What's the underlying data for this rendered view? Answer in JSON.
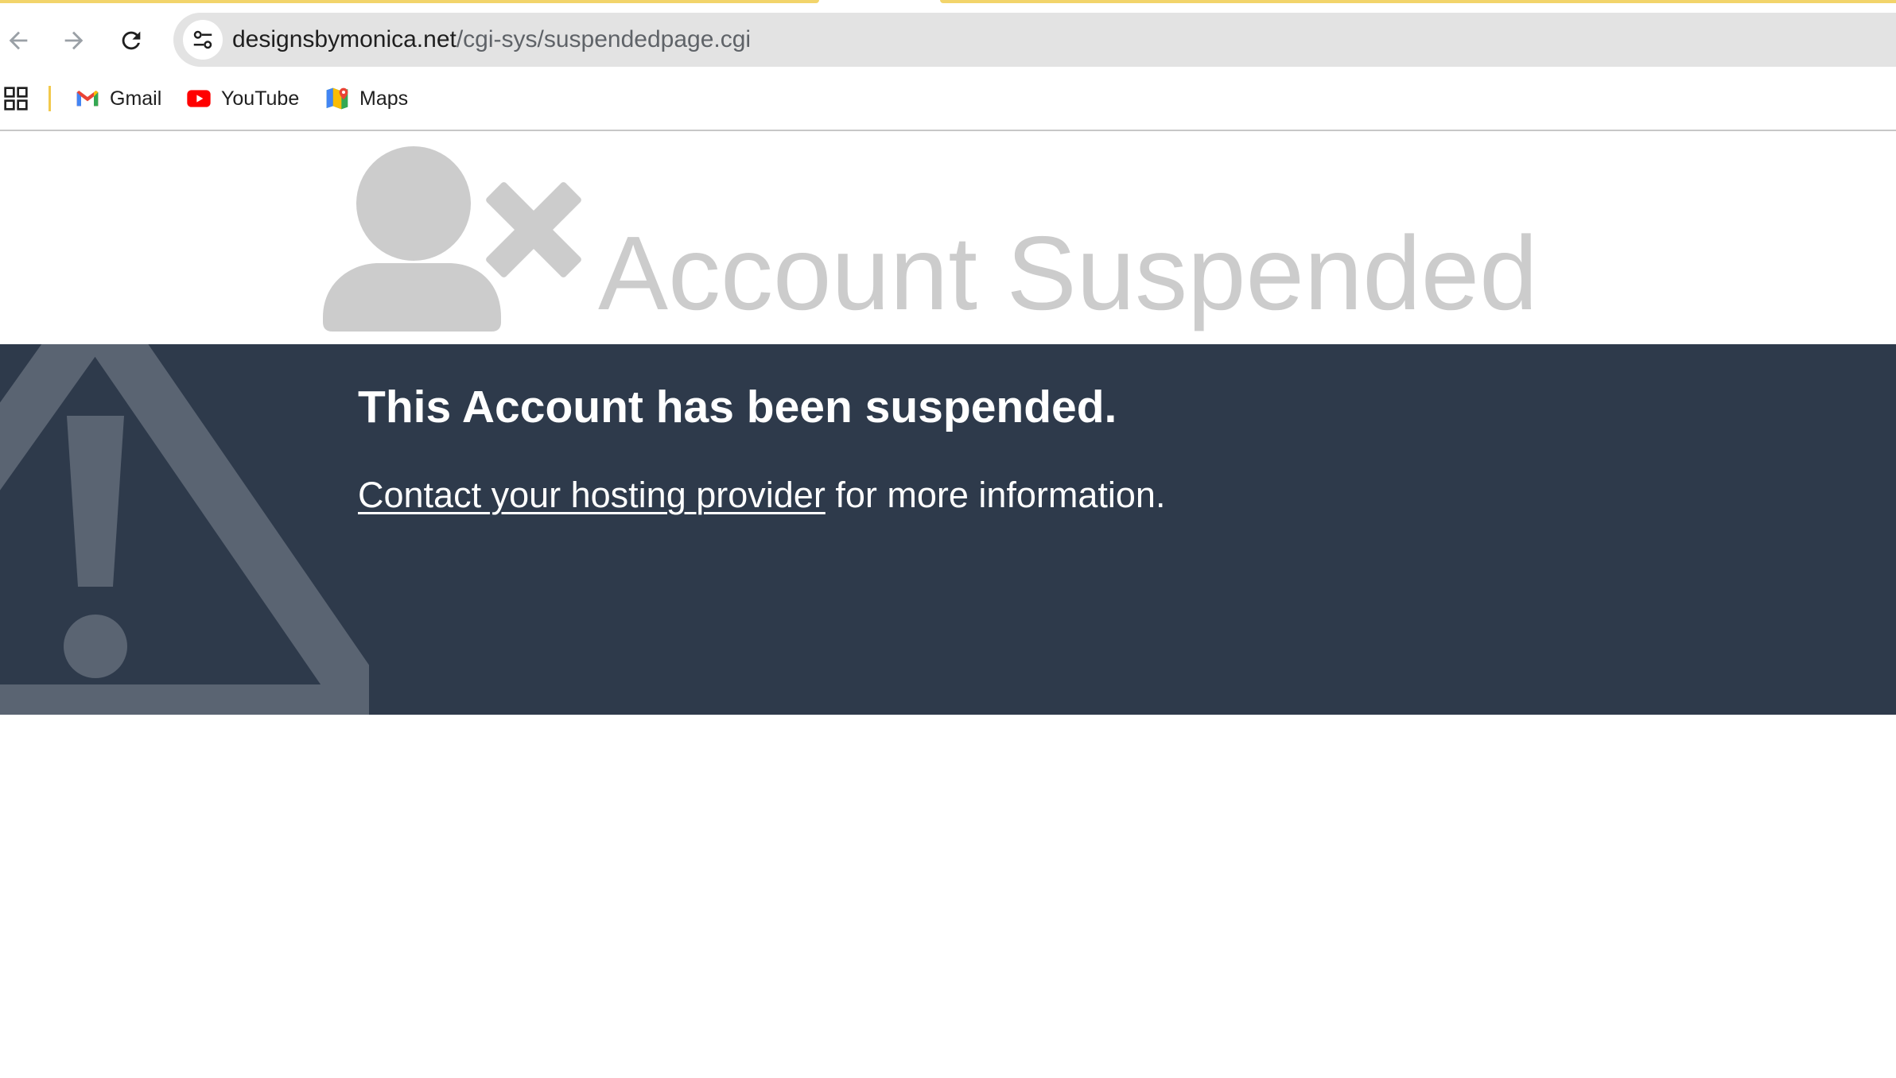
{
  "browser": {
    "url_host": "designsbymonica.net",
    "url_path": "/cgi-sys/suspendedpage.cgi",
    "nav_icons": [
      "back-arrow-icon",
      "forward-arrow-icon",
      "reload-icon",
      "tune-icon"
    ],
    "bookmarks": [
      {
        "label": "Gmail",
        "icon": "gmail-icon"
      },
      {
        "label": "YouTube",
        "icon": "youtube-icon"
      },
      {
        "label": "Maps",
        "icon": "maps-icon"
      }
    ]
  },
  "page": {
    "title": "Account Suspended",
    "heading": "This Account has been suspended.",
    "contact_link": "Contact your hosting provider",
    "contact_rest": " for more information.",
    "colors": {
      "band_background": "#2e3a4b",
      "title_gray": "#cccccc",
      "icon_gray": "#cccccc",
      "warning_overlay": "#5a6472"
    }
  }
}
